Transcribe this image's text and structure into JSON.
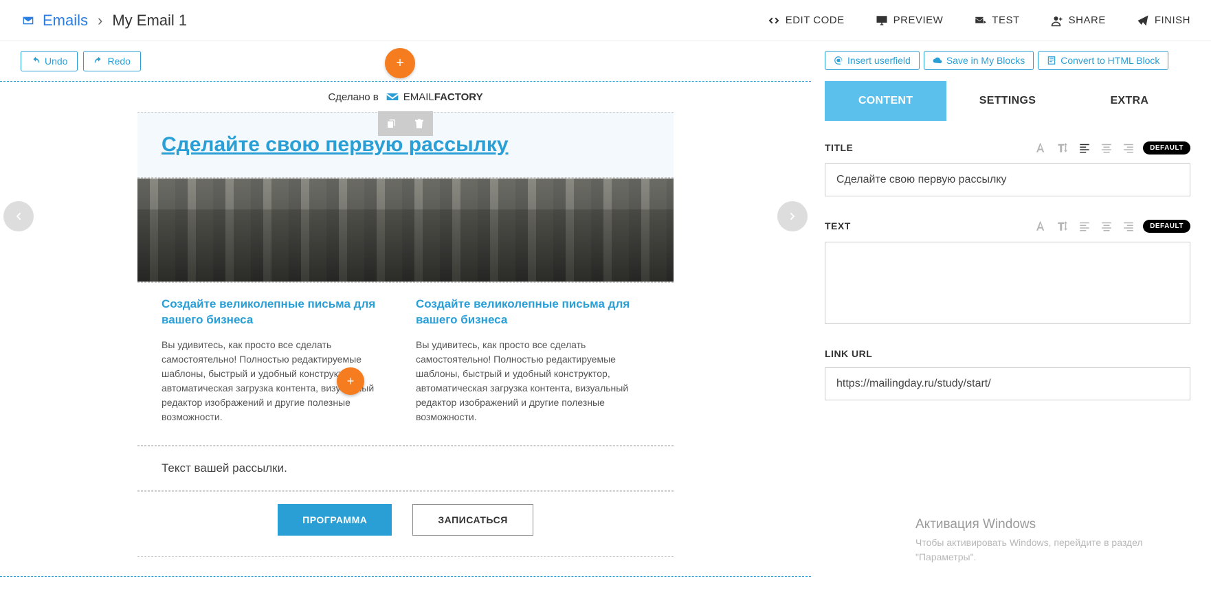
{
  "breadcrumb": {
    "root": "Emails",
    "current": "My Email 1"
  },
  "header_actions": {
    "edit_code": "EDIT CODE",
    "preview": "PREVIEW",
    "test": "TEST",
    "share": "SHARE",
    "finish": "FINISH"
  },
  "toolbar": {
    "undo": "Undo",
    "redo": "Redo"
  },
  "made_in": {
    "label": "Сделано в",
    "brand_1": "EMAIL",
    "brand_2": "FACTORY"
  },
  "email": {
    "title": "Сделайте свою первую рассылку",
    "col1_heading": "Создайте великолепные письма для вашего бизнеса",
    "col1_body": "Вы удивитесь, как просто все сделать самостоятельно! Полностью редактируемые шаблоны, быстрый и удобный конструктор, автоматическая загрузка контента, визуальный редактор изображений и другие полезные возможности.",
    "col2_heading": "Создайте великолепные письма для вашего бизнеса",
    "col2_body": "Вы удивитесь, как просто все сделать самостоятельно! Полностью редактируемые шаблоны, быстрый и удобный конструктор, автоматическая загрузка контента, визуальный редактор изображений и другие полезные возможности.",
    "text_row": "Текст вашей рассылки.",
    "btn_primary": "ПРОГРАММА",
    "btn_secondary": "ЗАПИСАТЬСЯ"
  },
  "right": {
    "block_btns": {
      "insert_userfield": "Insert userfield",
      "save_my_blocks": "Save in My Blocks",
      "convert_html": "Convert to HTML Block"
    },
    "tabs": {
      "content": "CONTENT",
      "settings": "SETTINGS",
      "extra": "EXTRA"
    },
    "title_label": "TITLE",
    "text_label": "TEXT",
    "link_label": "LINK URL",
    "chip_default": "DEFAULT",
    "title_value": "Сделайте свою первую рассылку",
    "text_value": "",
    "link_value": "https://mailingday.ru/study/start/"
  },
  "watermark": {
    "line1": "Активация Windows",
    "line2": "Чтобы активировать Windows, перейдите в раздел \"Параметры\"."
  }
}
